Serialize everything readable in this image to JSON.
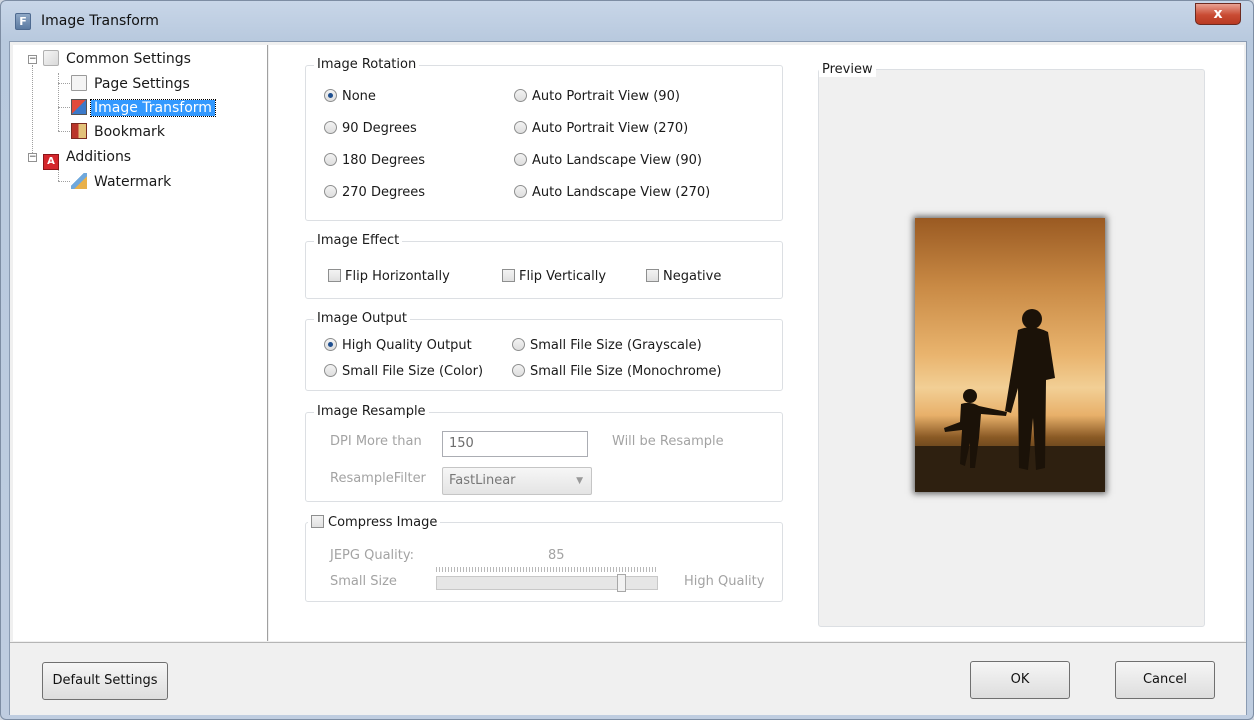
{
  "window": {
    "title": "Image Transform",
    "close_label": "x"
  },
  "tree": {
    "items": [
      {
        "label": "Common Settings"
      },
      {
        "label": "Page Settings"
      },
      {
        "label": "Image Transform"
      },
      {
        "label": "Bookmark"
      },
      {
        "label": "Additions"
      },
      {
        "label": "Watermark"
      }
    ]
  },
  "rotation": {
    "title": "Image Rotation",
    "options": [
      "None",
      "90 Degrees",
      "180 Degrees",
      "270 Degrees",
      "Auto Portrait View (90)",
      "Auto Portrait View (270)",
      "Auto Landscape View (90)",
      "Auto Landscape View (270)"
    ],
    "selected": "None"
  },
  "effect": {
    "title": "Image Effect",
    "options": [
      "Flip Horizontally",
      "Flip Vertically",
      "Negative"
    ]
  },
  "output": {
    "title": "Image Output",
    "options": [
      "High Quality Output",
      "Small File Size (Grayscale)",
      "Small File Size (Color)",
      "Small File Size (Monochrome)"
    ],
    "selected": "High Quality Output"
  },
  "resample": {
    "title": "Image Resample",
    "dpi_label": "DPI More than",
    "dpi_value": "150",
    "dpi_suffix": "Will be Resample",
    "filter_label": "ResampleFilter",
    "filter_value": "FastLinear"
  },
  "compress": {
    "title": "Compress Image",
    "quality_label": "JEPG Quality:",
    "quality_value": "85",
    "small_label": "Small Size",
    "high_label": "High Quality",
    "slider_fraction": 0.85
  },
  "preview": {
    "title": "Preview"
  },
  "buttons": {
    "default": "Default Settings",
    "ok": "OK",
    "cancel": "Cancel"
  }
}
